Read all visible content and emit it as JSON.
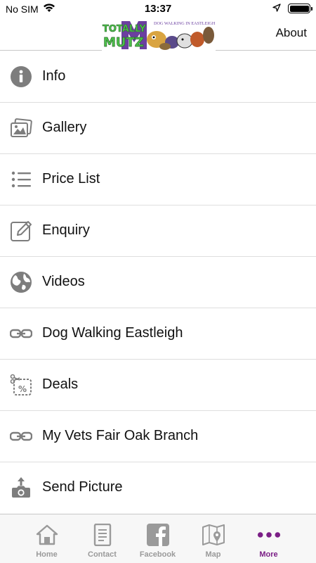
{
  "status_bar": {
    "carrier": "No SIM",
    "time": "13:37"
  },
  "nav": {
    "logo_text_top": "TOTALLY",
    "logo_text_bottom": "MUTZ",
    "logo_tagline": "DOG WALKING IN EASTLEIGH",
    "about_label": "About"
  },
  "menu": {
    "items": [
      {
        "label": "Info",
        "icon": "info-icon"
      },
      {
        "label": "Gallery",
        "icon": "gallery-icon"
      },
      {
        "label": "Price List",
        "icon": "list-icon"
      },
      {
        "label": "Enquiry",
        "icon": "edit-icon"
      },
      {
        "label": "Videos",
        "icon": "globe-icon"
      },
      {
        "label": "Dog Walking Eastleigh",
        "icon": "link-icon"
      },
      {
        "label": "Deals",
        "icon": "coupon-icon"
      },
      {
        "label": "My Vets Fair Oak Branch",
        "icon": "link-icon"
      },
      {
        "label": "Send Picture",
        "icon": "camera-upload-icon"
      }
    ]
  },
  "tab_bar": {
    "tabs": [
      {
        "label": "Home",
        "icon": "home-icon",
        "active": false
      },
      {
        "label": "Contact",
        "icon": "contact-icon",
        "active": false
      },
      {
        "label": "Facebook",
        "icon": "facebook-icon",
        "active": false
      },
      {
        "label": "Map",
        "icon": "map-icon",
        "active": false
      },
      {
        "label": "More",
        "icon": "more-icon",
        "active": true
      }
    ]
  },
  "colors": {
    "icon_gray": "#7d7d7d",
    "active_tab": "#7b1f86",
    "inactive_tab": "#9a9a9a",
    "logo_green": "#4cc04a",
    "logo_purple": "#6b3fa0"
  }
}
